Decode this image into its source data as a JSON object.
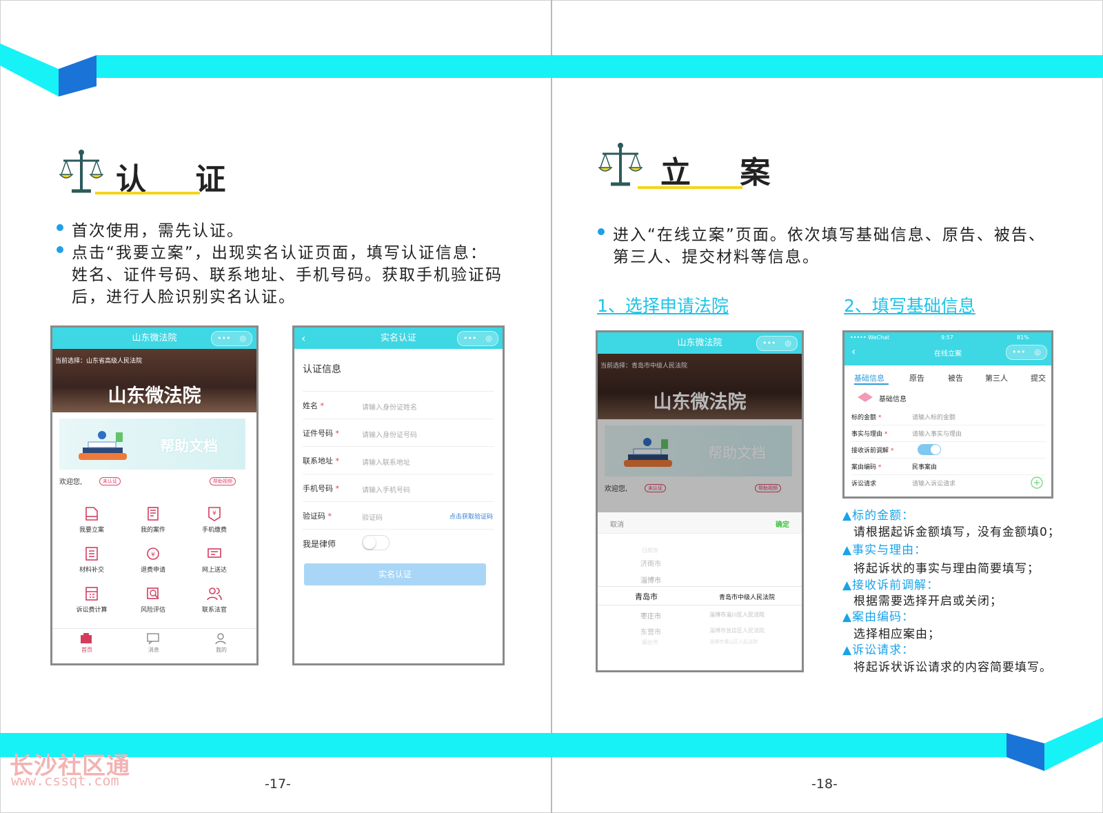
{
  "colors": {
    "band": "#17f2f7",
    "accent_blue": "#1fa0e8",
    "heading_underline": "#f5d51a",
    "link": "#1ec3e6"
  },
  "left_page": {
    "heading": "认 证",
    "bullets": [
      "首次使用，需先认证。",
      "点击“我要立案”，出现实名认证页面，填写认证信息：",
      "姓名、证件号码、联系地址、手机号码。获取手机验证码",
      "后，进行人脸识别实名认证。"
    ],
    "page_number": "-17-",
    "phone1": {
      "title": "山东微法院",
      "capsule_dots": "•••",
      "current_select": "当前选择：山东省高级人民法院",
      "banner_title": "山东微法院",
      "help_text": "帮助文档",
      "welcome": "欢迎您,",
      "badge": "未认证",
      "video": "帮助视频",
      "grid": [
        "我要立案",
        "我的案件",
        "手机缴费",
        "材料补交",
        "退费申请",
        "网上送达",
        "诉讼费计算",
        "风险评估",
        "联系法官"
      ],
      "tabs": [
        "首页",
        "消息",
        "我的"
      ]
    },
    "phone2": {
      "title": "实名认证",
      "section": "认证信息",
      "fields": [
        {
          "label": "姓名",
          "placeholder": "请输入身份证姓名"
        },
        {
          "label": "证件号码",
          "placeholder": "请输入身份证号码"
        },
        {
          "label": "联系地址",
          "placeholder": "请输入联系地址"
        },
        {
          "label": "手机号码",
          "placeholder": "请输入手机号码"
        },
        {
          "label": "验证码",
          "placeholder": "验证码"
        }
      ],
      "get_code": "点击获取验证码",
      "lawyer": "我是律师",
      "submit": "实名认证"
    }
  },
  "right_page": {
    "heading": "立 案",
    "bullets": [
      "进入“在线立案”页面。依次填写基础信息、原告、被告、",
      "第三人、提交材料等信息。"
    ],
    "step1": "1、选择申请法院",
    "step2": "2、填写基础信息",
    "page_number": "-18-",
    "phone3": {
      "title": "山东微法院",
      "current_select": "当前选择：青岛市中级人民法院",
      "banner_title": "山东微法院",
      "help_text": "帮助文档",
      "welcome": "欢迎您,",
      "badge": "未认证",
      "video": "帮助视频",
      "cancel": "取消",
      "confirm": "确定",
      "cities": [
        "日照市",
        "济南市",
        "淄博市",
        "青岛市",
        "枣庄市",
        "东营市",
        "烟台市"
      ],
      "selected_city": "青岛市",
      "selected_court": "青岛市中级人民法院",
      "courts": [
        "淄博市淄川区人民法院",
        "淄博市张店区人民法院",
        "淄博市博山区人民法院"
      ]
    },
    "phone4": {
      "status_left": "••••• WeChat",
      "status_time": "9:57",
      "status_right": "81%",
      "title": "在线立案",
      "tabs": [
        "基础信息",
        "原告",
        "被告",
        "第三人",
        "提交"
      ],
      "section": "基础信息",
      "fields": [
        {
          "label": "标的金额",
          "placeholder": "请输入标的金额"
        },
        {
          "label": "事实与理由",
          "placeholder": "请输入事实与理由"
        },
        {
          "label": "接收诉前调解",
          "placeholder": ""
        },
        {
          "label": "案由编码",
          "placeholder": "民事案由"
        },
        {
          "label": "诉讼请求",
          "placeholder": "请输入诉讼请求"
        }
      ]
    },
    "notes": [
      {
        "title": "▲标的金额：",
        "text": "请根据起诉金额填写，没有金额填0；"
      },
      {
        "title": "▲事实与理由：",
        "text": "将起诉状的事实与理由简要填写；"
      },
      {
        "title": "▲接收诉前调解：",
        "text": "根据需要选择开启或关闭；"
      },
      {
        "title": "▲案由编码：",
        "text": "选择相应案由；"
      },
      {
        "title": "▲诉讼请求：",
        "text": "将起诉状诉讼请求的内容简要填写。"
      }
    ]
  },
  "watermark": {
    "cn": "长沙社区通",
    "url": "www.cssqt.com"
  }
}
